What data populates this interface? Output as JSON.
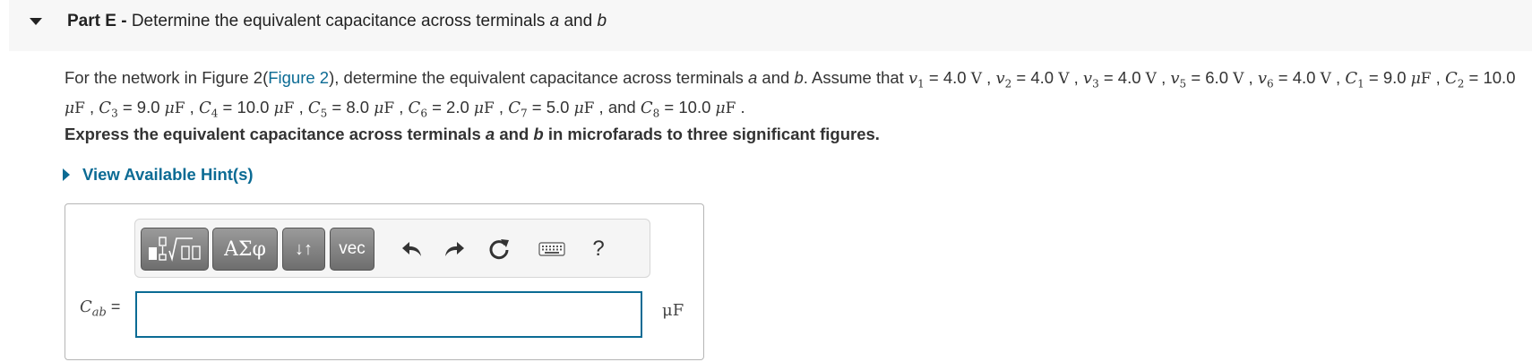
{
  "part": {
    "label": "Part E -",
    "title_pre": "Determine the equivalent capacitance across terminals ",
    "title_a": "a",
    "title_and": " and ",
    "title_b": "b"
  },
  "problem": {
    "intro": "For the network in Figure 2(",
    "figure_link": "Figure 2",
    "after_link": "), determine the equivalent capacitance across terminals ",
    "term_a": "a",
    "and": " and ",
    "term_b": "b",
    "assume": ". Assume that ",
    "values": [
      {
        "sym": "v",
        "sub": "1",
        "val": "4.0",
        "unit": "V"
      },
      {
        "sym": "v",
        "sub": "2",
        "val": "4.0",
        "unit": "V"
      },
      {
        "sym": "v",
        "sub": "3",
        "val": "4.0",
        "unit": "V"
      },
      {
        "sym": "v",
        "sub": "5",
        "val": "6.0",
        "unit": "V"
      },
      {
        "sym": "v",
        "sub": "6",
        "val": "4.0",
        "unit": "V"
      },
      {
        "sym": "C",
        "sub": "1",
        "val": "9.0",
        "unit": "μF"
      },
      {
        "sym": "C",
        "sub": "2",
        "val": "10.0",
        "unit": "μF"
      },
      {
        "sym": "C",
        "sub": "3",
        "val": "9.0",
        "unit": "μF"
      },
      {
        "sym": "C",
        "sub": "4",
        "val": "10.0",
        "unit": "μF"
      },
      {
        "sym": "C",
        "sub": "5",
        "val": "8.0",
        "unit": "μF"
      },
      {
        "sym": "C",
        "sub": "6",
        "val": "2.0",
        "unit": "μF"
      },
      {
        "sym": "C",
        "sub": "7",
        "val": "5.0",
        "unit": "μF"
      },
      {
        "sym": "C",
        "sub": "8",
        "val": "10.0",
        "unit": "μF"
      }
    ],
    "and_word": "and",
    "end": "."
  },
  "express": {
    "pre": "Express the equivalent capacitance across terminals ",
    "a": "a",
    "and": " and ",
    "b": "b",
    "post": " in microfarads to three significant figures."
  },
  "hint": {
    "label": "View Available Hint(s)"
  },
  "toolbar": {
    "greek_label": "ΑΣφ",
    "swap_label": "↓↑",
    "vec_label": "vec",
    "help_label": "?"
  },
  "answer": {
    "lhs_symbol": "C",
    "lhs_sub": "ab",
    "equals": " =",
    "value": "",
    "units": "μF"
  }
}
